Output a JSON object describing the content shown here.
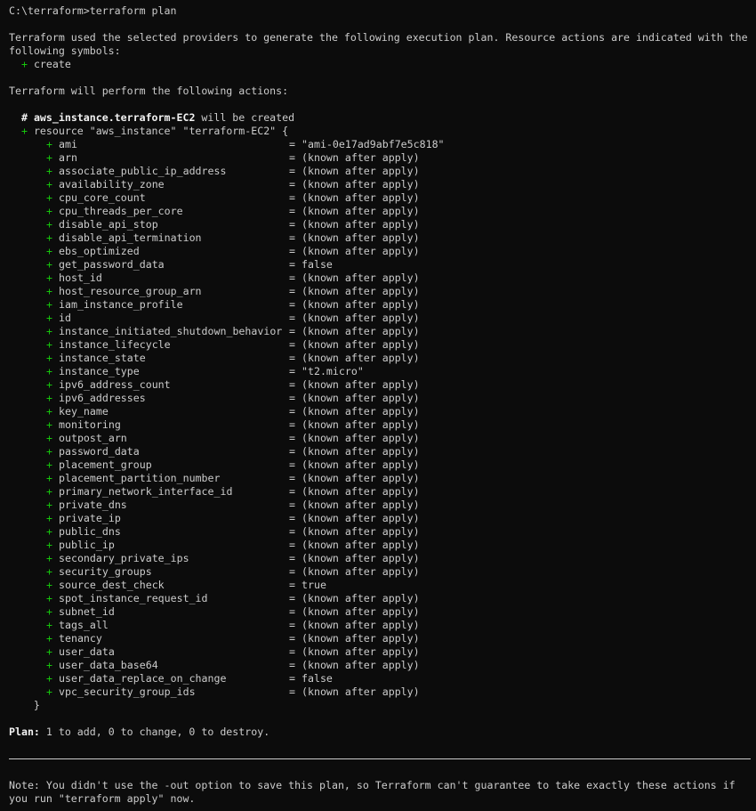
{
  "terminal": {
    "prompt": "C:\\terraform>terraform plan",
    "intro_line1": "Terraform used the selected providers to generate the following execution plan. Resource actions are indicated with the",
    "intro_line2": "following symbols:",
    "symbol_create": "+",
    "symbol_create_label": "create",
    "actions_heading": "Terraform will perform the following actions:",
    "resource_comment_hash": "#",
    "resource_address": "aws_instance.terraform-EC2",
    "resource_comment_suffix": "will be created",
    "resource_open_plus": "+",
    "resource_open": "resource \"aws_instance\" \"terraform-EC2\" {",
    "resource_close": "}",
    "attribute_plus": "+",
    "attribute_eq": "=",
    "attributes": [
      {
        "name": "ami",
        "value": "\"ami-0e17ad9abf7e5c818\""
      },
      {
        "name": "arn",
        "value": "(known after apply)"
      },
      {
        "name": "associate_public_ip_address",
        "value": "(known after apply)"
      },
      {
        "name": "availability_zone",
        "value": "(known after apply)"
      },
      {
        "name": "cpu_core_count",
        "value": "(known after apply)"
      },
      {
        "name": "cpu_threads_per_core",
        "value": "(known after apply)"
      },
      {
        "name": "disable_api_stop",
        "value": "(known after apply)"
      },
      {
        "name": "disable_api_termination",
        "value": "(known after apply)"
      },
      {
        "name": "ebs_optimized",
        "value": "(known after apply)"
      },
      {
        "name": "get_password_data",
        "value": "false"
      },
      {
        "name": "host_id",
        "value": "(known after apply)"
      },
      {
        "name": "host_resource_group_arn",
        "value": "(known after apply)"
      },
      {
        "name": "iam_instance_profile",
        "value": "(known after apply)"
      },
      {
        "name": "id",
        "value": "(known after apply)"
      },
      {
        "name": "instance_initiated_shutdown_behavior",
        "value": "(known after apply)"
      },
      {
        "name": "instance_lifecycle",
        "value": "(known after apply)"
      },
      {
        "name": "instance_state",
        "value": "(known after apply)"
      },
      {
        "name": "instance_type",
        "value": "\"t2.micro\""
      },
      {
        "name": "ipv6_address_count",
        "value": "(known after apply)"
      },
      {
        "name": "ipv6_addresses",
        "value": "(known after apply)"
      },
      {
        "name": "key_name",
        "value": "(known after apply)"
      },
      {
        "name": "monitoring",
        "value": "(known after apply)"
      },
      {
        "name": "outpost_arn",
        "value": "(known after apply)"
      },
      {
        "name": "password_data",
        "value": "(known after apply)"
      },
      {
        "name": "placement_group",
        "value": "(known after apply)"
      },
      {
        "name": "placement_partition_number",
        "value": "(known after apply)"
      },
      {
        "name": "primary_network_interface_id",
        "value": "(known after apply)"
      },
      {
        "name": "private_dns",
        "value": "(known after apply)"
      },
      {
        "name": "private_ip",
        "value": "(known after apply)"
      },
      {
        "name": "public_dns",
        "value": "(known after apply)"
      },
      {
        "name": "public_ip",
        "value": "(known after apply)"
      },
      {
        "name": "secondary_private_ips",
        "value": "(known after apply)"
      },
      {
        "name": "security_groups",
        "value": "(known after apply)"
      },
      {
        "name": "source_dest_check",
        "value": "true"
      },
      {
        "name": "spot_instance_request_id",
        "value": "(known after apply)"
      },
      {
        "name": "subnet_id",
        "value": "(known after apply)"
      },
      {
        "name": "tags_all",
        "value": "(known after apply)"
      },
      {
        "name": "tenancy",
        "value": "(known after apply)"
      },
      {
        "name": "user_data",
        "value": "(known after apply)"
      },
      {
        "name": "user_data_base64",
        "value": "(known after apply)"
      },
      {
        "name": "user_data_replace_on_change",
        "value": "false"
      },
      {
        "name": "vpc_security_group_ids",
        "value": "(known after apply)"
      }
    ],
    "plan_label": "Plan:",
    "plan_summary": "1 to add, 0 to change, 0 to destroy.",
    "note_line1": "Note: You didn't use the -out option to save this plan, so Terraform can't guarantee to take exactly these actions if",
    "note_line2": "you run \"terraform apply\" now."
  },
  "colors": {
    "background": "#0c0c0c",
    "foreground": "#cccccc",
    "create_green": "#16c60c",
    "bold_white": "#f2f2f2"
  }
}
